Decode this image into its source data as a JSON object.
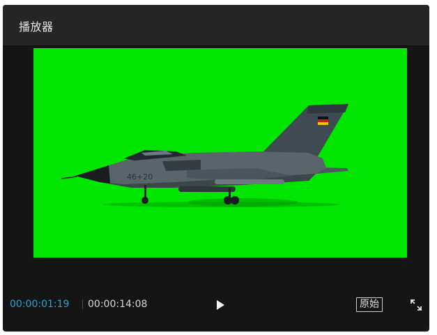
{
  "window": {
    "title": "播放器"
  },
  "timecode": {
    "current": "00:00:01:19",
    "total": "00:00:14:08"
  },
  "controls": {
    "play_icon": "play-icon",
    "original_label": "原始",
    "fullscreen_icon": "fullscreen-icon"
  },
  "video": {
    "background_color": "#00e600",
    "subject": "fighter jet on green screen"
  },
  "colors": {
    "panel": "#151515",
    "titlebar": "#262626",
    "timecode_current": "#2aa3d9",
    "text": "#d9d9d9"
  }
}
